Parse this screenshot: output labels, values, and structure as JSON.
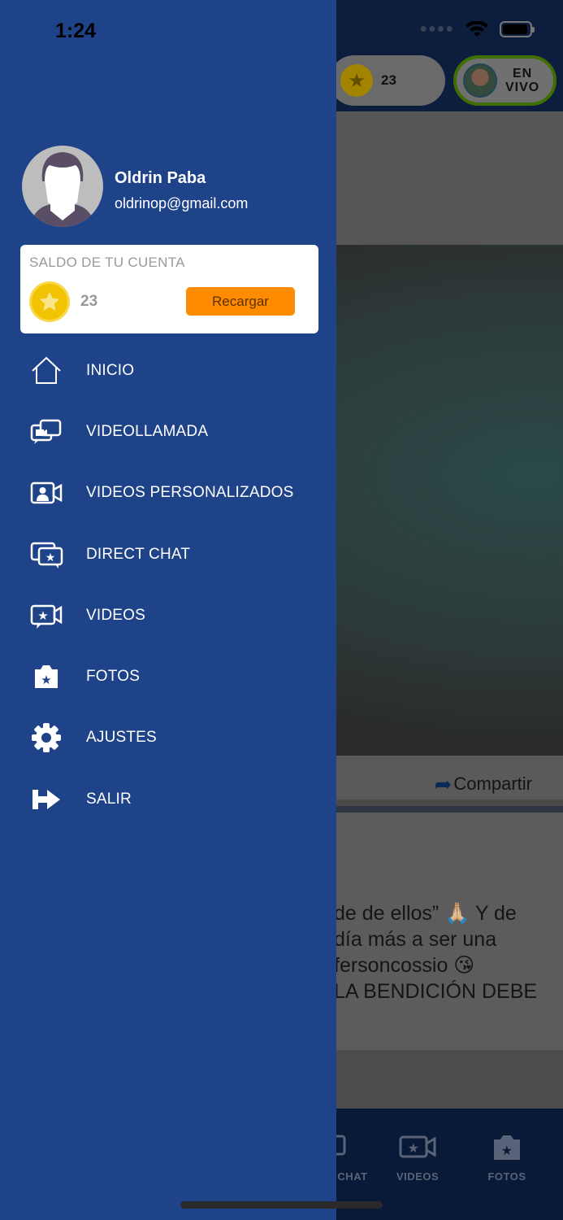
{
  "status_bar": {
    "time": "1:24"
  },
  "background_app": {
    "coins": "23",
    "live_label_1": "EN",
    "live_label_2": "VIVO",
    "share_label": "Compartir",
    "post_text": "de de ellos” 🙏🏼 Y de\ndía más a ser una\nfersoncossio 😘\nLA BENDICIÓN DEBE",
    "tabs": [
      {
        "label": "CHAT",
        "icon": "chat-star-icon"
      },
      {
        "label": "VIDEOS",
        "icon": "video-star-icon"
      },
      {
        "label": "FOTOS",
        "icon": "camera-star-icon"
      }
    ]
  },
  "drawer": {
    "user": {
      "name": "Oldrin Paba",
      "email": "oldrinop@gmail.com"
    },
    "balance": {
      "title": "SALDO DE TU CUENTA",
      "value": "23",
      "recharge_label": "Recargar"
    },
    "menu": [
      {
        "label": "INICIO",
        "icon": "home-icon"
      },
      {
        "label": "VIDEOLLAMADA",
        "icon": "video-call-icon"
      },
      {
        "label": "VIDEOS PERSONALIZADOS",
        "icon": "personal-video-icon"
      },
      {
        "label": "DIRECT CHAT",
        "icon": "chat-star-icon"
      },
      {
        "label": "VIDEOS",
        "icon": "video-star-icon"
      },
      {
        "label": "FOTOS",
        "icon": "camera-star-icon"
      },
      {
        "label": "AJUSTES",
        "icon": "gear-icon"
      },
      {
        "label": "SALIR",
        "icon": "logout-icon"
      }
    ]
  },
  "colors": {
    "drawer_bg": "#1f4389",
    "accent_orange": "#ff8c00",
    "coin_gold": "#f2c300"
  }
}
